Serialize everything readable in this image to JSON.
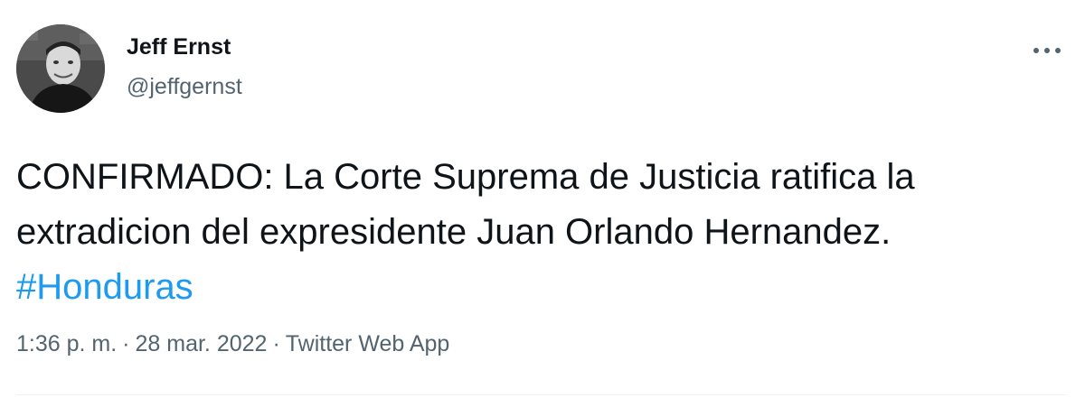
{
  "author": {
    "display_name": "Jeff Ernst",
    "handle": "@jeffgernst"
  },
  "more_icon": "more-horizontal-icon",
  "tweet": {
    "text": "CONFIRMADO: La Corte Suprema de Justicia ratifica la extradicion del expresidente Juan Orlando Hernandez.",
    "hashtag": "#Honduras",
    "hashtag_color": "#1d9bf0"
  },
  "meta": {
    "time": "1:36 p. m.",
    "separator": "·",
    "date": "28 mar. 2022",
    "source": "Twitter Web App"
  }
}
